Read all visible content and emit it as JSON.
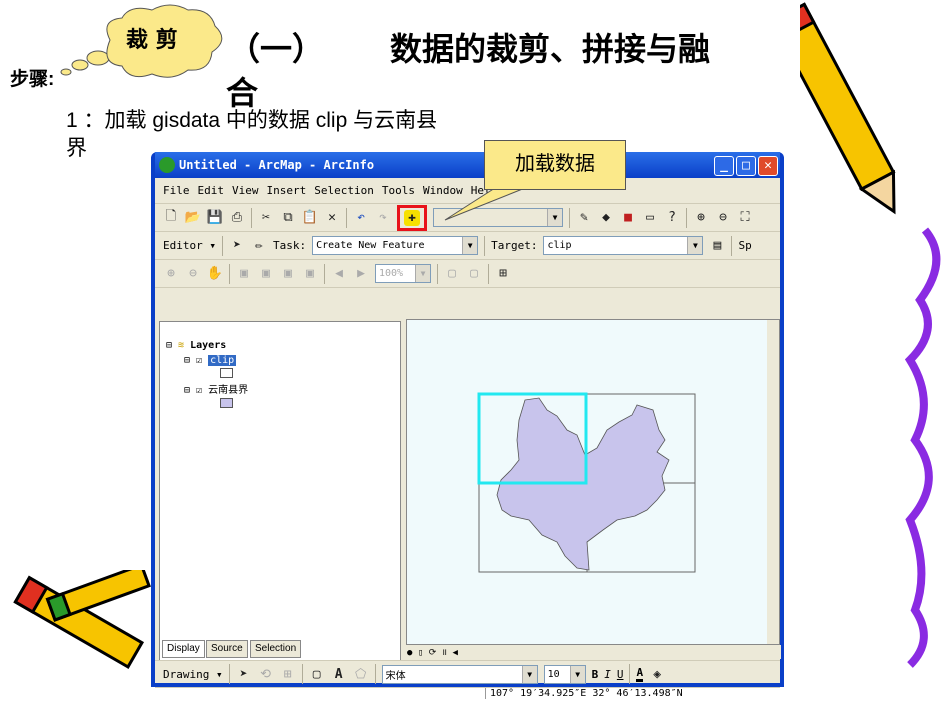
{
  "slide": {
    "steps_label": "步骤:",
    "cloud_label": "裁 剪",
    "title_prefix": "（一）",
    "title_main": "数据的裁剪、拼接与融",
    "title_wrap": "合",
    "step1": "1 ：加载 gisdata 中的数据 clip 与云南县",
    "step1_wrap": "界",
    "callout": "加载数据"
  },
  "window": {
    "title": "Untitled - ArcMap - ArcInfo",
    "menu": [
      "File",
      "Edit",
      "View",
      "Insert",
      "Selection",
      "Tools",
      "Window",
      "Help"
    ],
    "editor": {
      "label": "Editor ▾",
      "task_label": "Task:",
      "task_value": "Create New Feature",
      "target_label": "Target:",
      "target_value": "clip",
      "extra": "Sp"
    },
    "zoom_value": "100%",
    "toc": {
      "root": "Layers",
      "layers": [
        {
          "name": "clip",
          "checked": true,
          "swatch": "#ffffff"
        },
        {
          "name": "云南县界",
          "checked": true,
          "swatch": "#c8c4ec"
        }
      ],
      "tabs": [
        "Display",
        "Source",
        "Selection"
      ]
    },
    "drawing": {
      "label": "Drawing ▾",
      "font": "宋体",
      "size": "10",
      "bold": "B",
      "italic": "I",
      "underline": "U",
      "font_color": "A"
    },
    "status": {
      "coords": "107° 19′34.925″E  32° 46′13.498″N"
    }
  },
  "colors": {
    "titlebar": "#0a3fc8",
    "highlight": "#e8121a",
    "callout": "#fbe98a",
    "polygon": "#c8c4ec",
    "clip_box": "#22e8f0"
  }
}
